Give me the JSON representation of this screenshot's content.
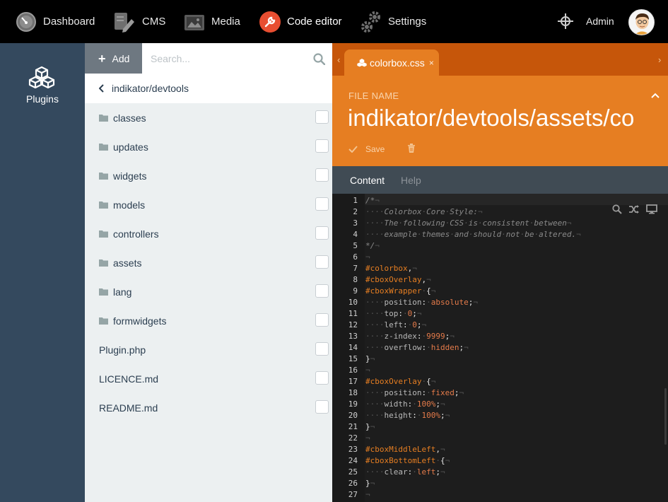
{
  "topbar": {
    "nav": [
      {
        "id": "dashboard",
        "label": "Dashboard",
        "icon": "speedometer-icon"
      },
      {
        "id": "cms",
        "label": "CMS",
        "icon": "document-pencil-icon"
      },
      {
        "id": "media",
        "label": "Media",
        "icon": "image-icon"
      },
      {
        "id": "code_editor",
        "label": "Code editor",
        "icon": "wrench-icon"
      },
      {
        "id": "settings",
        "label": "Settings",
        "icon": "gears-icon"
      }
    ],
    "admin_label": "Admin",
    "active_color": "#e84e31"
  },
  "sidebar": {
    "plugins_label": "Plugins"
  },
  "files": {
    "add_label": "Add",
    "search_placeholder": "Search...",
    "breadcrumb": "indikator/devtools",
    "items": [
      {
        "name": "classes",
        "type": "folder"
      },
      {
        "name": "updates",
        "type": "folder"
      },
      {
        "name": "widgets",
        "type": "folder"
      },
      {
        "name": "models",
        "type": "folder"
      },
      {
        "name": "controllers",
        "type": "folder"
      },
      {
        "name": "assets",
        "type": "folder"
      },
      {
        "name": "lang",
        "type": "folder"
      },
      {
        "name": "formwidgets",
        "type": "folder"
      },
      {
        "name": "Plugin.php",
        "type": "file"
      },
      {
        "name": "LICENCE.md",
        "type": "file"
      },
      {
        "name": "README.md",
        "type": "file"
      }
    ]
  },
  "editor": {
    "tab_label": "colorbox.css",
    "tab_close": "×",
    "arrow_left": "‹",
    "arrow_right": "›",
    "file_name_label": "FILE NAME",
    "file_name_value": "indikator/devtools/assets/co",
    "save_label": "Save",
    "subtabs": {
      "content": "Content",
      "help": "Help"
    },
    "accent": "#e67e22",
    "code_lines": [
      "/*¬",
      "····Colorbox·Core·Style:¬",
      "····The·following·CSS·is·consistent·between¬",
      "····example·themes·and·should·not·be·altered.¬",
      "*/¬",
      "¬",
      "#colorbox,¬",
      "#cboxOverlay,¬",
      "#cboxWrapper·{¬",
      "····position:·absolute;¬",
      "····top:·0;¬",
      "····left:·0;¬",
      "····z-index:·9999;¬",
      "····overflow:·hidden;¬",
      "}¬",
      "¬",
      "#cboxOverlay·{¬",
      "····position:·fixed;¬",
      "····width:·100%;¬",
      "····height:·100%;¬",
      "}¬",
      "¬",
      "#cboxMiddleLeft,¬",
      "#cboxBottomLeft·{¬",
      "····clear:·left;¬",
      "}¬",
      "¬"
    ]
  }
}
